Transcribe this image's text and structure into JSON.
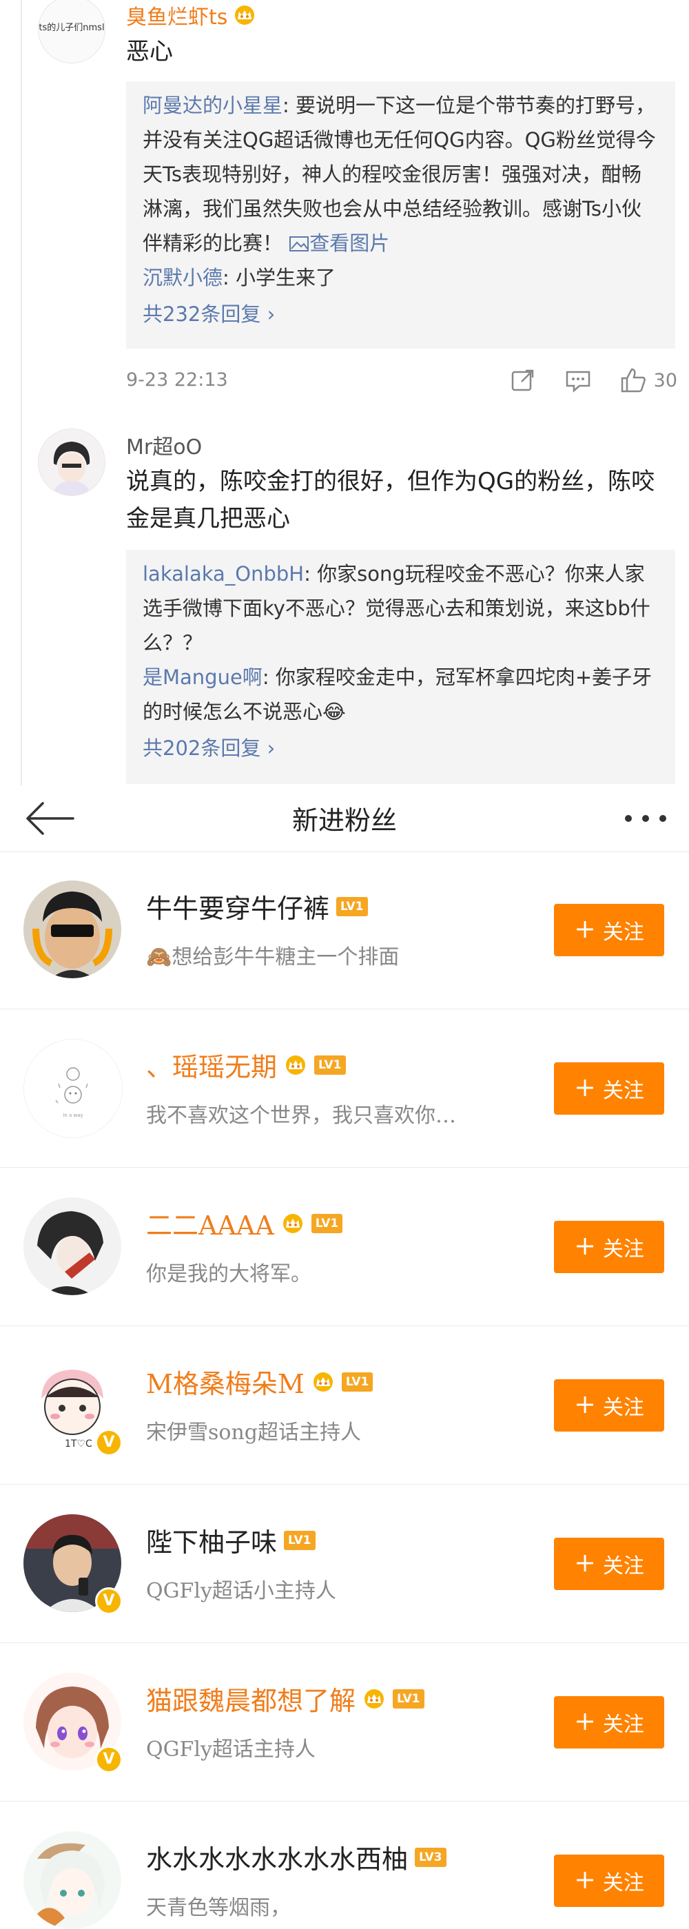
{
  "comments": [
    {
      "avatar_text": "ts的儿子们nmsl",
      "user": "臭鱼烂虾ts",
      "user_style": "orange",
      "crown": true,
      "text": "恶心",
      "replies": [
        {
          "user": "阿曼达的小星星",
          "text": "要说明一下这一位是个带节奏的打野号，并没有关注QG超话微博也无任何QG内容。QG粉丝觉得今天Ts表现特别好，神人的程咬金很厉害！强强对决，酣畅淋漓，我们虽然失败也会从中总结经验教训。感谢Ts小伙伴精彩的比赛！",
          "extra": "查看图片"
        },
        {
          "user": "沉默小德",
          "text": "小学生来了",
          "extra": ""
        }
      ],
      "more_replies": "共232条回复 ›",
      "time": "9-23 22:13",
      "likes": "30"
    },
    {
      "avatar_text": "",
      "user": "Mr超oO",
      "user_style": "gray",
      "crown": false,
      "text": "说真的，陈咬金打的很好，但作为QG的粉丝，陈咬金是真几把恶心",
      "replies": [
        {
          "user": "lakalaka_OnbbH",
          "text": "你家song玩程咬金不恶心？你来人家选手微博下面ky不恶心？觉得恶心去和策划说，来这bb什么？？",
          "extra": ""
        },
        {
          "user": "是Mangue啊",
          "text": "你家程咬金走中，冠军杯拿四坨肉+姜子牙的时候怎么不说恶心😂",
          "extra": ""
        }
      ],
      "more_replies": "共202条回复 ›"
    }
  ],
  "fans_page": {
    "title": "新进粉丝",
    "follow_label": "关注",
    "fans": [
      {
        "name": "牛牛要穿牛仔裤",
        "name_style": "dark",
        "crown": false,
        "level": "LV1",
        "desc": "🙈想给彭牛牛糖主一个排面",
        "verified": false
      },
      {
        "name": "、瑶瑶无期",
        "name_style": "orange",
        "crown": true,
        "level": "LV1",
        "desc": "我不喜欢这个世界，我只喜欢你…",
        "verified": false
      },
      {
        "name": "二二AAAA",
        "name_style": "orange",
        "crown": true,
        "level": "LV1",
        "desc": "你是我的大将军。",
        "verified": false
      },
      {
        "name": "M格桑梅朵M",
        "name_style": "orange",
        "crown": true,
        "level": "LV1",
        "desc": "宋伊雪song超话主持人",
        "verified": true
      },
      {
        "name": "陛下柚子味",
        "name_style": "dark",
        "crown": false,
        "level": "LV1",
        "desc": "QGFly超话小主持人",
        "verified": true
      },
      {
        "name": "猫跟魏晨都想了解",
        "name_style": "orange",
        "crown": true,
        "level": "LV1",
        "desc": "QGFly超话主持人",
        "verified": true
      },
      {
        "name": "水水水水水水水水西柚",
        "name_style": "dark",
        "crown": false,
        "level": "LV3",
        "desc": "天青色等烟雨，",
        "verified": false
      }
    ]
  },
  "colors": {
    "accent": "#ff8200",
    "link": "#5b79ad",
    "vip_name": "#f07d1b"
  }
}
